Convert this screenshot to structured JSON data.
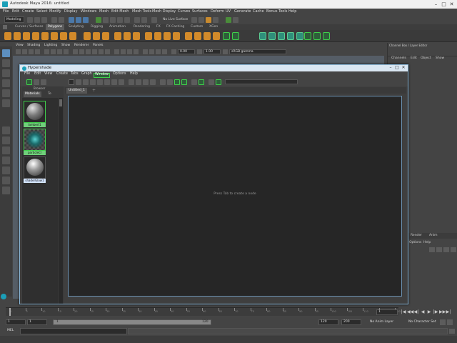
{
  "window": {
    "title": "Autodesk Maya 2016: untitled",
    "minimize": "–",
    "maximize": "□",
    "close": "✕"
  },
  "menubar": [
    "File",
    "Edit",
    "Create",
    "Select",
    "Modify",
    "Display",
    "Windows",
    "Mesh",
    "Edit Mesh",
    "Mesh Tools",
    "Mesh Display",
    "Curves",
    "Surfaces",
    "Deform",
    "UV",
    "Generate",
    "Cache",
    "Bonus Tools",
    "Help"
  ],
  "statusline": {
    "mode": "Modeling",
    "live_surface": "No Live Surface"
  },
  "shelf_tabs": [
    "Curves / Surfaces",
    "Polygons",
    "Sculpting",
    "Rigging",
    "Animation",
    "Rendering",
    "FX",
    "FX Caching",
    "Custom",
    "XGen"
  ],
  "shelf_active_tab": "Polygons",
  "viewport": {
    "menu": [
      "View",
      "Shading",
      "Lighting",
      "Show",
      "Renderer",
      "Panels"
    ],
    "field_a": "0.00",
    "field_b": "1.00",
    "color_space": "sRGB gamma"
  },
  "channel_box": {
    "title": "Channel Box / Layer Editor",
    "tabs": [
      "Channels",
      "Edit",
      "Object",
      "Show"
    ],
    "layer_tabs": [
      "Display",
      "Render",
      "Anim"
    ],
    "layer_menu": [
      "Layers",
      "Options",
      "Help"
    ]
  },
  "hypershade": {
    "title": "Hypershade",
    "menu": [
      "File",
      "Edit",
      "View",
      "Create",
      "Tabs",
      "Graph",
      "Window",
      "Options",
      "Help"
    ],
    "highlight_menu": "Window",
    "browser_title": "Browser",
    "browser_tabs": [
      "Materials",
      "Te"
    ],
    "materials": [
      {
        "name": "lambert1",
        "color": "#8a8a8a"
      },
      {
        "name": "particleCl",
        "color": "#2a8a8a"
      },
      {
        "name": "shaderGlow1",
        "color": "#9a9a9a"
      }
    ],
    "graph_tab": "Untitled_1",
    "graph_tab_close": "+",
    "hint": "Press Tab to create a node"
  },
  "timeline": {
    "ticks": [
      "1",
      "5",
      "10",
      "15",
      "20",
      "25",
      "30",
      "35",
      "40",
      "45",
      "50",
      "55",
      "60",
      "65",
      "70",
      "75",
      "80",
      "85",
      "90",
      "95",
      "100",
      "105",
      "110",
      "115",
      "120"
    ],
    "current_frame": "1",
    "playback_controls": [
      "|◀",
      "◀◀",
      "◀|",
      "◀",
      "▶",
      "|▶",
      "▶▶",
      "▶|"
    ]
  },
  "range": {
    "start": "1",
    "playback_start": "1",
    "slider_start": "1",
    "slider_end": "120",
    "playback_end": "120",
    "end": "200",
    "anim_layer": "No Anim Layer",
    "character_set": "No Character Set"
  },
  "command_line": {
    "label": "MEL"
  },
  "colors": {
    "accent_green": "#3fd04a",
    "selection_blue": "#5d8fbf",
    "maya_teal": "#1b9fb8"
  }
}
